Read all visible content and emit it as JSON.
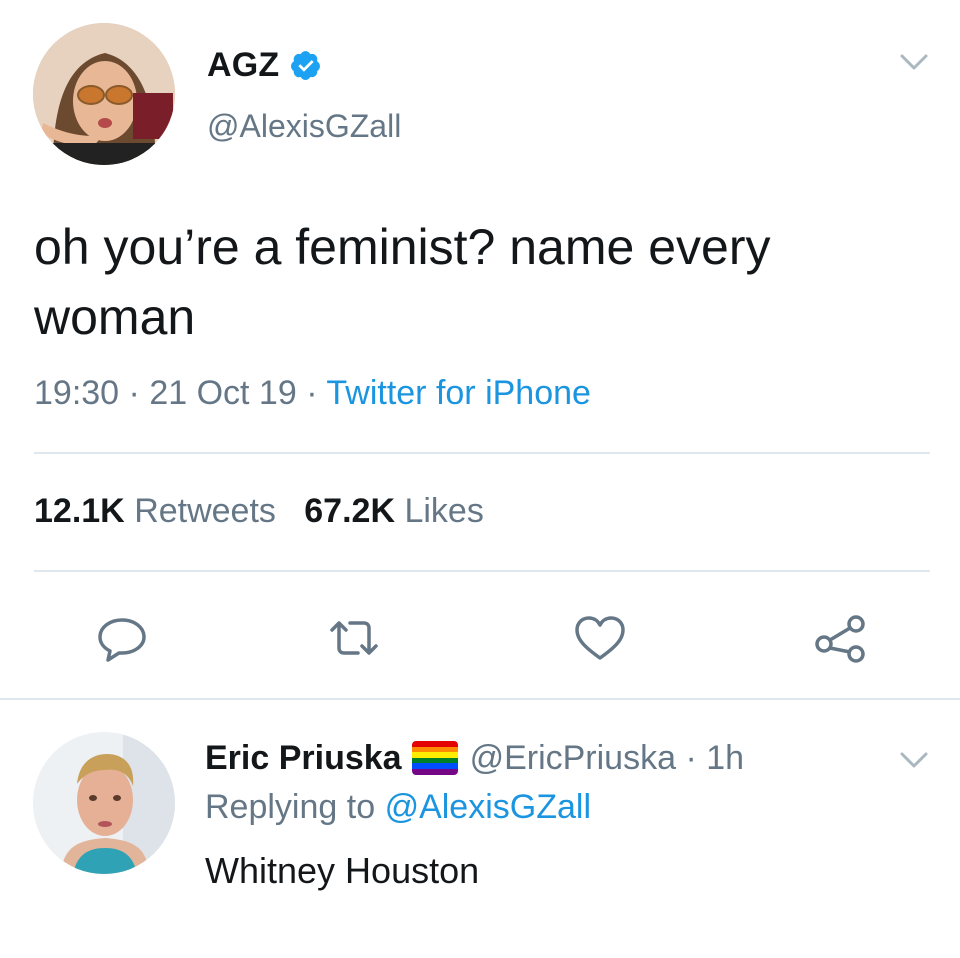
{
  "tweet": {
    "display_name": "AGZ",
    "verified_icon": "verified-badge-icon",
    "handle": "@AlexisGZall",
    "text": "oh you’re a feminist? name every woman",
    "time": "19:30",
    "date": "21 Oct 19",
    "separator": "·",
    "source": "Twitter for iPhone",
    "retweets_count": "12.1K",
    "retweets_label": "Retweets",
    "likes_count": "67.2K",
    "likes_label": "Likes",
    "actions": [
      "reply-icon",
      "retweet-icon",
      "like-icon",
      "share-icon"
    ]
  },
  "reply": {
    "display_name": "Eric Priuska",
    "flag_icon": "rainbow-flag-icon",
    "handle": "@EricPriuska",
    "separator": "·",
    "age": "1h",
    "replying_prefix": "Replying to",
    "replying_to": "@AlexisGZall",
    "text": "Whitney Houston"
  },
  "colors": {
    "text_primary": "#14171a",
    "text_secondary": "#657786",
    "link": "#1b95e0",
    "verified": "#1da1f2",
    "divider": "#e1e8ed"
  }
}
